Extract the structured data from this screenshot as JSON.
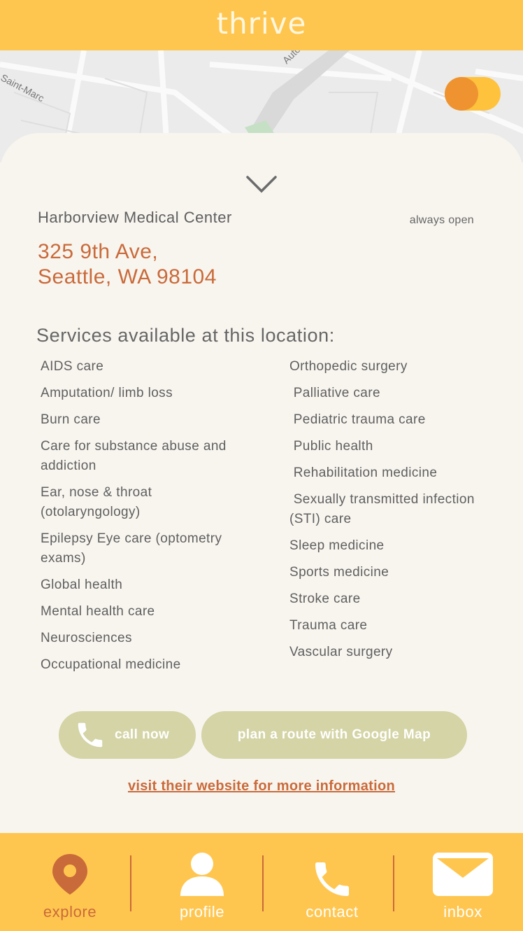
{
  "app": {
    "brand": "thrive"
  },
  "map": {
    "street_labels": [
      "Saint-Marc",
      "Auto"
    ]
  },
  "toggle": {
    "state": "on"
  },
  "location": {
    "name": "Harborview Medical Center",
    "hours": "always open",
    "address_line1": "325 9th Ave,",
    "address_line2": "Seattle, WA 98104"
  },
  "services": {
    "title": "Services available at this location:",
    "left": [
      "AIDS care",
      "Amputation/ limb loss",
      "Burn care",
      "Care for substance abuse and addiction",
      "Ear, nose & throat (otolaryngology)",
      "Epilepsy Eye care (optometry exams)",
      "Global health",
      "Mental health care",
      "Neurosciences",
      "Occupational medicine"
    ],
    "right": [
      "Orthopedic surgery",
      " Palliative care",
      " Pediatric trauma care",
      " Public health",
      " Rehabilitation medicine",
      " Sexually transmitted infection (STI) care",
      "Sleep medicine",
      "Sports medicine",
      "Stroke care",
      "Trauma care",
      "Vascular surgery"
    ]
  },
  "actions": {
    "call_label": "call now",
    "route_label": "plan a route with Google Map",
    "website_link": "visit their website for more information"
  },
  "nav": {
    "items": [
      {
        "label": "explore",
        "icon": "location-pin-icon",
        "active": true
      },
      {
        "label": "profile",
        "icon": "person-icon",
        "active": false
      },
      {
        "label": "contact",
        "icon": "phone-icon",
        "active": false
      },
      {
        "label": "inbox",
        "icon": "envelope-icon",
        "active": false
      }
    ]
  },
  "colors": {
    "header": "#ffc64f",
    "accent": "#c96a3a",
    "button": "#d4d4a6",
    "toggle_knob": "#ee9330",
    "sheet": "#f8f5ef"
  }
}
